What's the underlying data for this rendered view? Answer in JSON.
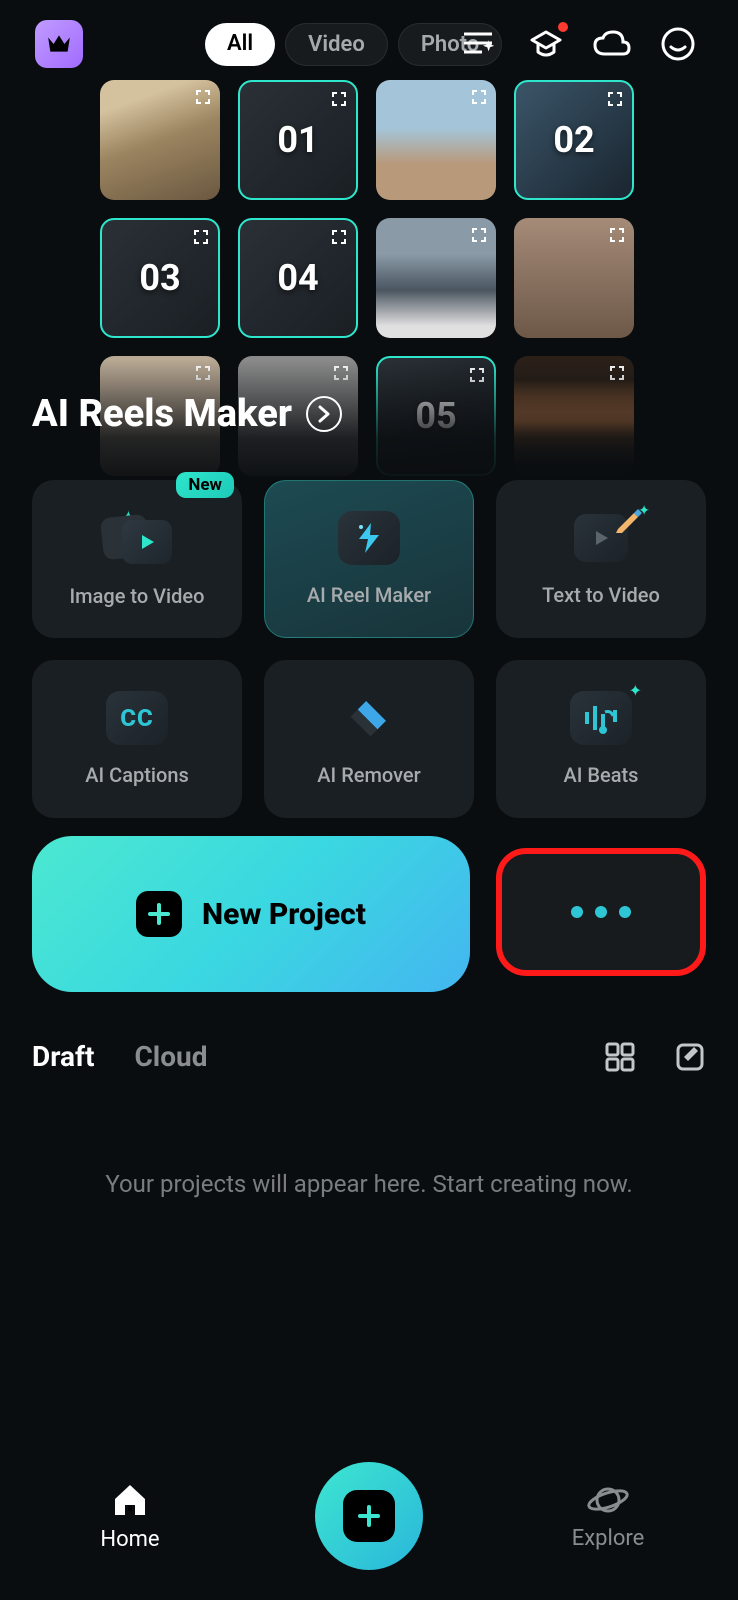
{
  "header": {
    "filters": [
      "All",
      "Video",
      "Photo"
    ],
    "active_filter": 0
  },
  "templates": {
    "tiles": [
      "",
      "01",
      "",
      "02",
      "03",
      "04",
      "",
      "",
      "",
      "",
      "05",
      ""
    ]
  },
  "section": {
    "title": "AI Reels Maker"
  },
  "tools": [
    {
      "label": "Image to Video",
      "badge": "New"
    },
    {
      "label": "AI Reel Maker"
    },
    {
      "label": "Text to Video"
    },
    {
      "label": "AI Captions"
    },
    {
      "label": "AI Remover"
    },
    {
      "label": "AI Beats"
    }
  ],
  "new_project": {
    "label": "New Project"
  },
  "drafts": {
    "tabs": [
      "Draft",
      "Cloud"
    ],
    "active_tab": 0,
    "empty_message": "Your projects will appear here. Start creating now."
  },
  "nav": {
    "home": "Home",
    "explore": "Explore"
  }
}
